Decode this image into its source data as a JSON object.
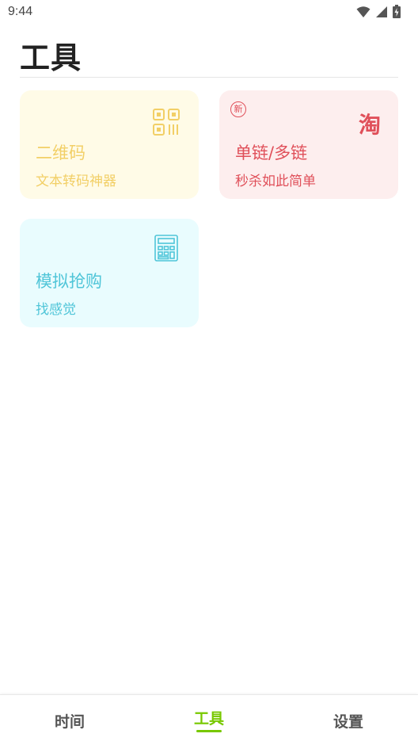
{
  "status_bar": {
    "time": "9:44"
  },
  "header": {
    "title": "工具"
  },
  "cards": [
    {
      "title": "二维码",
      "subtitle": "文本转码神器",
      "icon": "qrcode-icon"
    },
    {
      "title": "单链/多链",
      "subtitle": "秒杀如此简单",
      "icon": "taobao-icon",
      "badge": "新",
      "icon_text": "淘"
    },
    {
      "title": "模拟抢购",
      "subtitle": "找感觉",
      "icon": "calculator-icon"
    }
  ],
  "bottom_nav": {
    "items": [
      {
        "label": "时间"
      },
      {
        "label": "工具"
      },
      {
        "label": "设置"
      }
    ],
    "active_index": 1
  },
  "colors": {
    "accent": "#78c800",
    "qrcode": "#f2cf66",
    "link": "#e0505a",
    "sim": "#4fc5d8"
  }
}
